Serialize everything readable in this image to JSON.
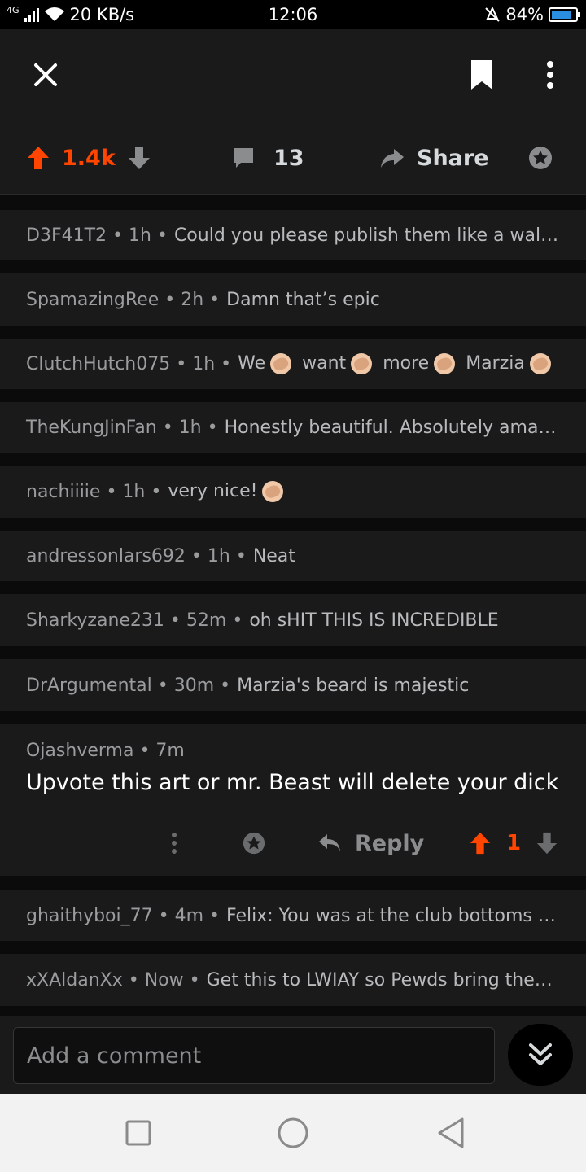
{
  "status_bar": {
    "network": "4G",
    "speed": "20 KB/s",
    "time": "12:06",
    "battery": "84%",
    "battery_level": 0.84
  },
  "header": {
    "close_icon": "close-icon",
    "bookmark_icon": "bookmark-icon",
    "more_icon": "more-vertical-icon"
  },
  "action_bar": {
    "vote_count": "1.4k",
    "comment_count": "13",
    "share_label": "Share",
    "colors": {
      "upvote": "#ff4500"
    }
  },
  "comments": [
    {
      "author": "D3F41T2",
      "time": "1h",
      "text": "Could you please publish them like a wallp..."
    },
    {
      "author": "SpamazingRee",
      "time": "2h",
      "text": "Damn that’s epic"
    },
    {
      "author": "ClutchHutch075",
      "time": "1h",
      "text_parts": [
        "We",
        "want",
        "more",
        "Marzia"
      ]
    },
    {
      "author": "TheKungJinFan",
      "time": "1h",
      "text": "Honestly beautiful. Absolutely amazi..."
    },
    {
      "author": "nachiiiie",
      "time": "1h",
      "text": "very nice!"
    },
    {
      "author": "andressonlars692",
      "time": "1h",
      "text": "Neat"
    },
    {
      "author": "Sharkyzane231",
      "time": "52m",
      "text": "oh sHIT THIS IS INCREDIBLE"
    },
    {
      "author": "DrArgumental",
      "time": "30m",
      "text": "Marzia's beard is majestic"
    }
  ],
  "expanded_comment": {
    "author": "Ojashverma",
    "time": "7m",
    "body": "Upvote this art or mr. Beast will delete your dick",
    "reply_label": "Reply",
    "vote_count": "1"
  },
  "comments_after": [
    {
      "author": "ghaithyboi_77",
      "time": "4m",
      "text": "Felix: You was at the club bottoms up..."
    },
    {
      "author": "xXAldanXx",
      "time": "Now",
      "text": "Get this to LWIAY so Pewds bring them ..."
    }
  ],
  "composer": {
    "placeholder": "Add a comment"
  }
}
